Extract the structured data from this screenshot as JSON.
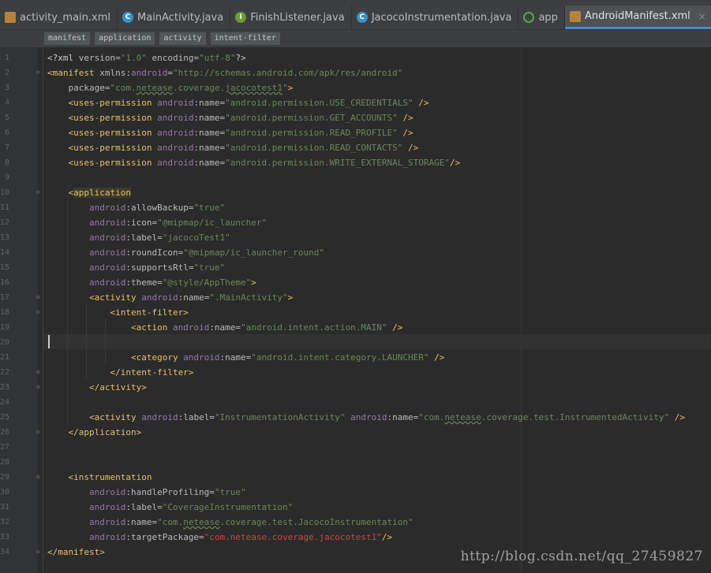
{
  "tabs": [
    {
      "label": "activity_main.xml",
      "icon": "xml-file-icon",
      "kind": "xml",
      "active": false,
      "close": ""
    },
    {
      "label": "MainActivity.java",
      "icon": "class-icon",
      "kind": "class",
      "glyph": "C",
      "active": false,
      "close": ""
    },
    {
      "label": "FinishListener.java",
      "icon": "interface-icon",
      "kind": "iface",
      "glyph": "I",
      "active": false,
      "close": ""
    },
    {
      "label": "JacocoInstrumentation.java",
      "icon": "class-icon",
      "kind": "class",
      "glyph": "C",
      "active": false,
      "close": ""
    },
    {
      "label": "app",
      "icon": "app-module-icon",
      "kind": "app",
      "active": false,
      "close": ""
    },
    {
      "label": "AndroidManifest.xml",
      "icon": "xml-file-icon",
      "kind": "xml",
      "active": true,
      "close": "×"
    }
  ],
  "breadcrumbs": [
    "manifest",
    "application",
    "activity",
    "intent-filter"
  ],
  "line_numbers": [
    "1",
    "2",
    "3",
    "4",
    "5",
    "6",
    "7",
    "8",
    "9",
    "10",
    "11",
    "12",
    "13",
    "14",
    "15",
    "16",
    "17",
    "18",
    "19",
    "20",
    "21",
    "22",
    "23",
    "24",
    "25",
    "26",
    "27",
    "28",
    "29",
    "30",
    "31",
    "32",
    "33",
    "34"
  ],
  "watermark": "http://blog.csdn.net/qq_27459827",
  "code_lines": [
    [
      [
        "pi",
        "<?xml "
      ],
      [
        "at",
        "version="
      ],
      [
        "vl",
        "\"1.0\""
      ],
      [
        "at",
        " encoding="
      ],
      [
        "vl",
        "\"utf-8\""
      ],
      [
        "pi",
        "?>"
      ]
    ],
    [
      [
        "tg",
        "<manifest "
      ],
      [
        "at",
        "xmlns:"
      ],
      [
        "ns",
        "android"
      ],
      [
        "at",
        "="
      ],
      [
        "vl",
        "\"http://schemas.android.com/apk/res/android\""
      ]
    ],
    [
      [
        "at",
        "    package="
      ],
      [
        "vl",
        "\"com."
      ],
      [
        "vlu",
        "netease"
      ],
      [
        "vl",
        ".coverage."
      ],
      [
        "vlu",
        "jacocotest1"
      ],
      [
        "vl",
        "\""
      ],
      [
        "tg",
        ">"
      ]
    ],
    [
      [
        "tg",
        "    <uses-permission "
      ],
      [
        "ns",
        "android"
      ],
      [
        "at",
        ":name="
      ],
      [
        "vl",
        "\"android.permission.USE_CREDENTIALS\""
      ],
      [
        "tg",
        " />"
      ]
    ],
    [
      [
        "tg",
        "    <uses-permission "
      ],
      [
        "ns",
        "android"
      ],
      [
        "at",
        ":name="
      ],
      [
        "vl",
        "\"android.permission.GET_ACCOUNTS\""
      ],
      [
        "tg",
        " />"
      ]
    ],
    [
      [
        "tg",
        "    <uses-permission "
      ],
      [
        "ns",
        "android"
      ],
      [
        "at",
        ":name="
      ],
      [
        "vl",
        "\"android.permission.READ_PROFILE\""
      ],
      [
        "tg",
        " />"
      ]
    ],
    [
      [
        "tg",
        "    <uses-permission "
      ],
      [
        "ns",
        "android"
      ],
      [
        "at",
        ":name="
      ],
      [
        "vl",
        "\"android.permission.READ_CONTACTS\""
      ],
      [
        "tg",
        " />"
      ]
    ],
    [
      [
        "tg",
        "    <uses-permission "
      ],
      [
        "ns",
        "android"
      ],
      [
        "at",
        ":name="
      ],
      [
        "vl",
        "\"android.permission.WRITE_EXTERNAL_STORAGE\""
      ],
      [
        "tg",
        "/>"
      ]
    ],
    [],
    [
      [
        "tg",
        "    <"
      ],
      [
        "tgh",
        "application"
      ]
    ],
    [
      [
        "ns",
        "        android"
      ],
      [
        "at",
        ":allowBackup="
      ],
      [
        "vl",
        "\"true\""
      ]
    ],
    [
      [
        "ns",
        "        android"
      ],
      [
        "at",
        ":icon="
      ],
      [
        "vl",
        "\"@mipmap/ic_launcher\""
      ]
    ],
    [
      [
        "ns",
        "        android"
      ],
      [
        "at",
        ":label="
      ],
      [
        "vl",
        "\"jacocoTest1\""
      ]
    ],
    [
      [
        "ns",
        "        android"
      ],
      [
        "at",
        ":roundIcon="
      ],
      [
        "vl",
        "\"@mipmap/ic_launcher_round\""
      ]
    ],
    [
      [
        "ns",
        "        android"
      ],
      [
        "at",
        ":supportsRtl="
      ],
      [
        "vl",
        "\"true\""
      ]
    ],
    [
      [
        "ns",
        "        android"
      ],
      [
        "at",
        ":theme="
      ],
      [
        "vl",
        "\"@style/AppTheme\""
      ],
      [
        "tg",
        ">"
      ]
    ],
    [
      [
        "tg",
        "        <activity "
      ],
      [
        "ns",
        "android"
      ],
      [
        "at",
        ":name="
      ],
      [
        "vl",
        "\".MainActivity\""
      ],
      [
        "tg",
        ">"
      ]
    ],
    [
      [
        "tg",
        "            <intent-filter>"
      ]
    ],
    [
      [
        "tg",
        "                <action "
      ],
      [
        "ns",
        "android"
      ],
      [
        "at",
        ":name="
      ],
      [
        "vl",
        "\"android.intent.action.MAIN\""
      ],
      [
        "tg",
        " />"
      ]
    ],
    [],
    [
      [
        "tg",
        "                <category "
      ],
      [
        "ns",
        "android"
      ],
      [
        "at",
        ":name="
      ],
      [
        "vl",
        "\"android.intent.category.LAUNCHER\""
      ],
      [
        "tg",
        " />"
      ]
    ],
    [
      [
        "tg",
        "            </intent-filter>"
      ]
    ],
    [
      [
        "tg",
        "        </activity>"
      ]
    ],
    [],
    [
      [
        "tg",
        "        <activity "
      ],
      [
        "ns",
        "android"
      ],
      [
        "at",
        ":label="
      ],
      [
        "vl",
        "\"InstrumentationActivity\""
      ],
      [
        "ns",
        " android"
      ],
      [
        "at",
        ":name="
      ],
      [
        "vl",
        "\"com."
      ],
      [
        "vlu",
        "netease"
      ],
      [
        "vl",
        ".coverage.test.InstrumentedActivity\""
      ],
      [
        "tg",
        " />"
      ]
    ],
    [
      [
        "tg",
        "    </application>"
      ]
    ],
    [],
    [],
    [
      [
        "tg",
        "    <instrumentation"
      ]
    ],
    [
      [
        "ns",
        "        android"
      ],
      [
        "at",
        ":handleProfiling="
      ],
      [
        "vl",
        "\"true\""
      ]
    ],
    [
      [
        "ns",
        "        android"
      ],
      [
        "at",
        ":label="
      ],
      [
        "vl",
        "\"CoverageInstrumentation\""
      ]
    ],
    [
      [
        "ns",
        "        android"
      ],
      [
        "at",
        ":name="
      ],
      [
        "vl",
        "\"com."
      ],
      [
        "vlu",
        "netease"
      ],
      [
        "vl",
        ".coverage.test.JacocoInstrumentation\""
      ]
    ],
    [
      [
        "ns",
        "        android"
      ],
      [
        "at",
        ":targetPackage="
      ],
      [
        "vr",
        "\"com.netease.coverage.jacocotest1\""
      ],
      [
        "tg",
        "/>"
      ]
    ],
    [
      [
        "tg",
        "</manifest>"
      ]
    ]
  ]
}
